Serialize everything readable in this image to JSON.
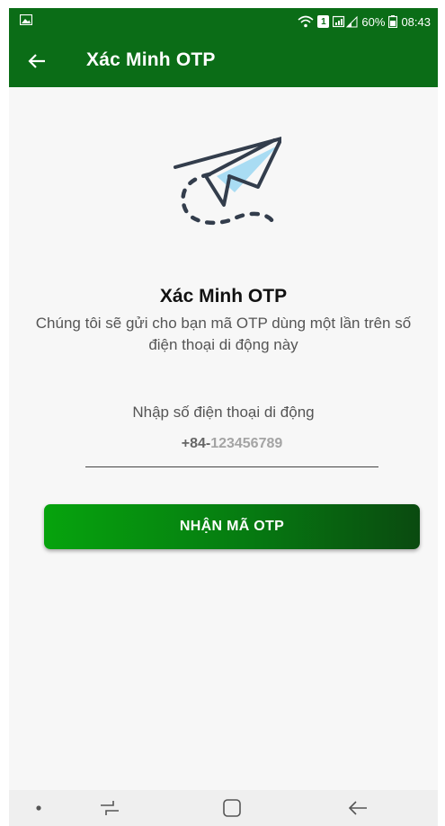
{
  "status_bar": {
    "battery": "60%",
    "time": "08:43",
    "sim_slot": "1",
    "icons": [
      "gallery-icon",
      "wifi-icon",
      "sim-icon",
      "signal-icon",
      "battery-icon"
    ]
  },
  "app_bar": {
    "title": "Xác Minh OTP",
    "back_icon": "arrow-left-icon"
  },
  "main": {
    "illustration_icon": "paper-plane-icon",
    "heading": "Xác Minh OTP",
    "description": "Chúng tôi sẽ gửi cho bạn mã OTP dùng một lần trên số điện thoại di động này",
    "phone_label": "Nhập số điện thoại di động",
    "phone_prefix": "+84-",
    "phone_number": "123456789",
    "button_label": "NHẬN MÃ OTP"
  },
  "colors": {
    "header": "#0b6d17",
    "button_start": "#06a30d",
    "button_end": "#0a4a10",
    "background": "#f7f7f7"
  },
  "nav_bar": {
    "items": [
      "dot-icon",
      "recent-apps-icon",
      "home-icon",
      "back-icon"
    ]
  }
}
